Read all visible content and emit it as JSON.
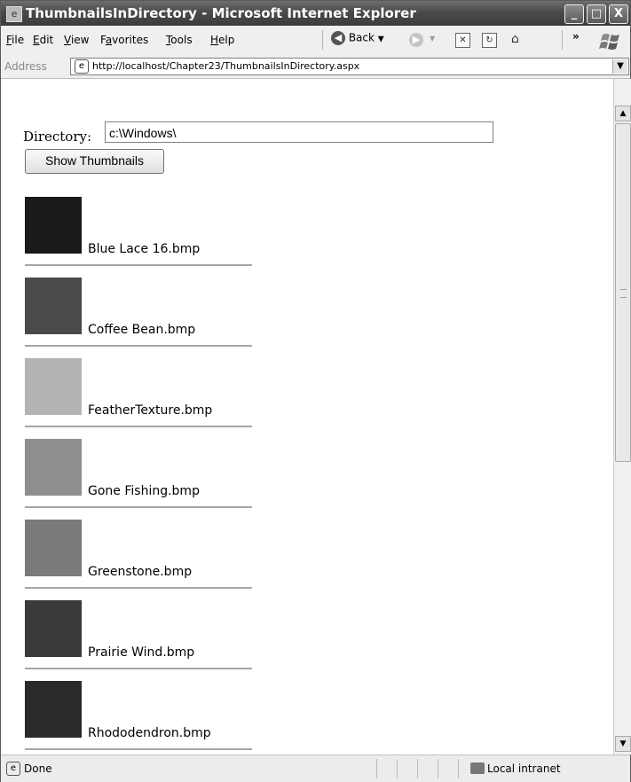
{
  "window": {
    "title": "ThumbnailsInDirectory - Microsoft Internet Explorer",
    "controls": {
      "minimize": "_",
      "maximize": "□",
      "close": "X"
    }
  },
  "menu": {
    "items": [
      {
        "label": "File",
        "hotkey": "F",
        "rest": "ile"
      },
      {
        "label": "Edit",
        "hotkey": "E",
        "rest": "dit"
      },
      {
        "label": "View",
        "hotkey": "V",
        "rest": "iew"
      },
      {
        "label": "Favorites",
        "hotkey": "a",
        "pre": "F",
        "rest": "vorites"
      },
      {
        "label": "Tools",
        "hotkey": "T",
        "rest": "ools"
      },
      {
        "label": "Help",
        "hotkey": "H",
        "rest": "elp"
      }
    ],
    "back_label": "Back",
    "overflow": "»"
  },
  "address": {
    "label": "Address",
    "url": "http://localhost/Chapter23/ThumbnailsInDirectory.aspx"
  },
  "page": {
    "directory_label": "Directory:",
    "directory_value": "c:\\Windows\\",
    "show_button": "Show Thumbnails",
    "thumbnails": [
      {
        "name": "Blue Lace 16.bmp",
        "color": "#1a1a1a"
      },
      {
        "name": "Coffee Bean.bmp",
        "color": "#4a4a4a"
      },
      {
        "name": "FeatherTexture.bmp",
        "color": "#b4b4b4"
      },
      {
        "name": "Gone Fishing.bmp",
        "color": "#8e8e8e"
      },
      {
        "name": "Greenstone.bmp",
        "color": "#7a7a7a"
      },
      {
        "name": "Prairie Wind.bmp",
        "color": "#3a3a3a"
      },
      {
        "name": "Rhododendron.bmp",
        "color": "#2a2a2a"
      }
    ]
  },
  "status": {
    "text": "Done",
    "zone": "Local intranet"
  }
}
